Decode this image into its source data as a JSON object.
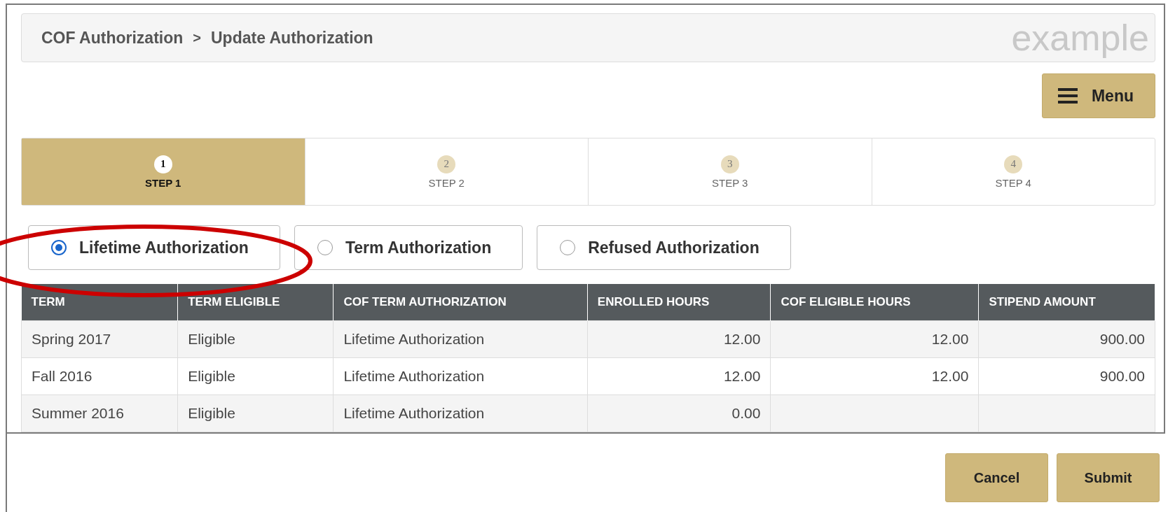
{
  "breadcrumb": {
    "items": [
      "COF Authorization",
      "Update Authorization"
    ],
    "separator": ">",
    "corner_label": "example"
  },
  "menu_button": {
    "label": "Menu"
  },
  "steps": [
    {
      "number": "1",
      "label": "STEP 1",
      "selected": true
    },
    {
      "number": "2",
      "label": "STEP 2",
      "selected": false
    },
    {
      "number": "3",
      "label": "STEP 3",
      "selected": false
    },
    {
      "number": "4",
      "label": "STEP 4",
      "selected": false
    }
  ],
  "authorization_options": [
    {
      "label": "Lifetime Authorization",
      "selected": true
    },
    {
      "label": "Term Authorization",
      "selected": false
    },
    {
      "label": "Refused Authorization",
      "selected": false
    }
  ],
  "annotation": {
    "kind": "ellipse",
    "color": "#cc0000"
  },
  "table": {
    "columns": [
      {
        "label": "TERM",
        "kind": "text"
      },
      {
        "label": "TERM ELIGIBLE",
        "kind": "text"
      },
      {
        "label": "COF TERM AUTHORIZATION",
        "kind": "text"
      },
      {
        "label": "ENROLLED HOURS",
        "kind": "number"
      },
      {
        "label": "COF ELIGIBLE HOURS",
        "kind": "number"
      },
      {
        "label": "STIPEND AMOUNT",
        "kind": "number"
      }
    ],
    "rows": [
      [
        "Spring 2017",
        "Eligible",
        "Lifetime Authorization",
        "12.00",
        "12.00",
        "900.00"
      ],
      [
        "Fall 2016",
        "Eligible",
        "Lifetime Authorization",
        "12.00",
        "12.00",
        "900.00"
      ],
      [
        "Summer 2016",
        "Eligible",
        "Lifetime Authorization",
        "0.00",
        null,
        null
      ]
    ]
  },
  "buttons": [
    "Cancel",
    "Submit"
  ]
}
